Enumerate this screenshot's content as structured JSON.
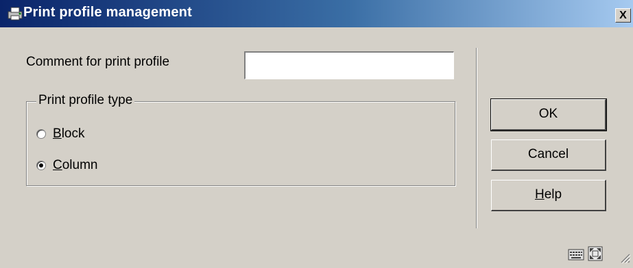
{
  "window": {
    "title": "Print profile management",
    "close_label": "X"
  },
  "form": {
    "comment_label": "Comment for print profile",
    "comment_value": "",
    "comment_placeholder": ""
  },
  "profile_type": {
    "legend": "Print profile type",
    "options": [
      {
        "mnemonic": "B",
        "rest": "lock",
        "checked": false
      },
      {
        "mnemonic": "C",
        "rest": "olumn",
        "checked": true
      }
    ]
  },
  "buttons": {
    "ok": "OK",
    "cancel": "Cancel",
    "help_mnemonic": "H",
    "help_rest": "elp"
  },
  "icons": {
    "title": "print-profile-icon",
    "status_left": "keyboard-icon",
    "status_right": "maximize-icon",
    "resize": "resize-grip-icon"
  },
  "colors": {
    "title_gradient_start": "#0a246a",
    "title_gradient_end": "#a6caf0",
    "dialog_bg": "#d4d0c8"
  }
}
